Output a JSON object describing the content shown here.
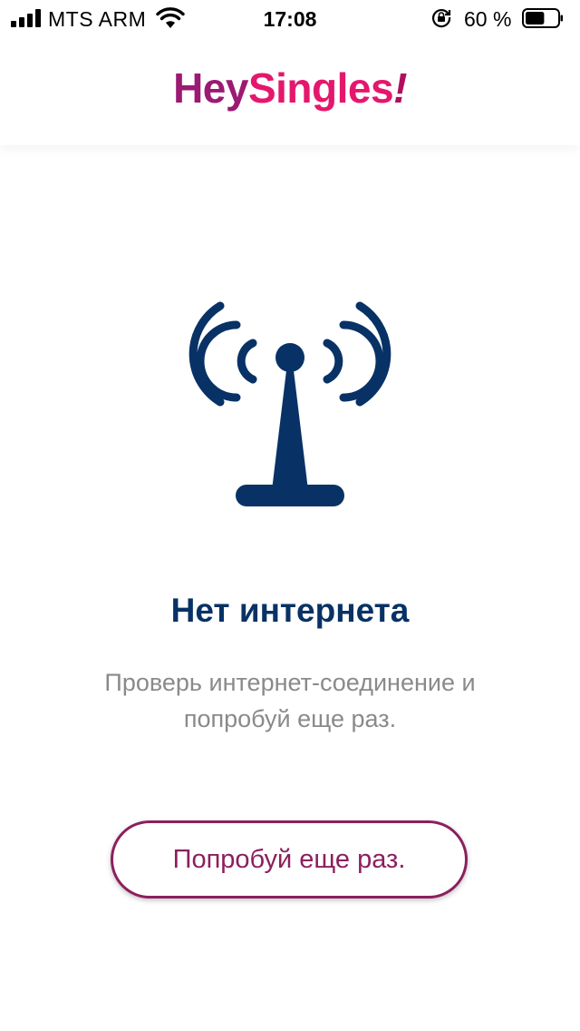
{
  "status_bar": {
    "carrier": "MTS ARM",
    "time": "17:08",
    "battery_percent": "60 %",
    "battery_level": 0.6,
    "icons": [
      "signal-icon",
      "wifi-icon",
      "orientation-lock-icon",
      "battery-icon"
    ]
  },
  "header": {
    "logo_hey": "Hey",
    "logo_singles": "Singles",
    "logo_bang": "!"
  },
  "main": {
    "icon": "antenna-tower-icon",
    "title": "Нет интернета",
    "message": "Проверь интернет-соединение и попробуй еще раз.",
    "retry_label": "Попробуй еще раз."
  },
  "colors": {
    "brand_purple": "#9b1a72",
    "brand_pink": "#e5176d",
    "title_navy": "#083266",
    "button_border": "#8c1f5e",
    "muted_text": "#8a8a8a"
  }
}
